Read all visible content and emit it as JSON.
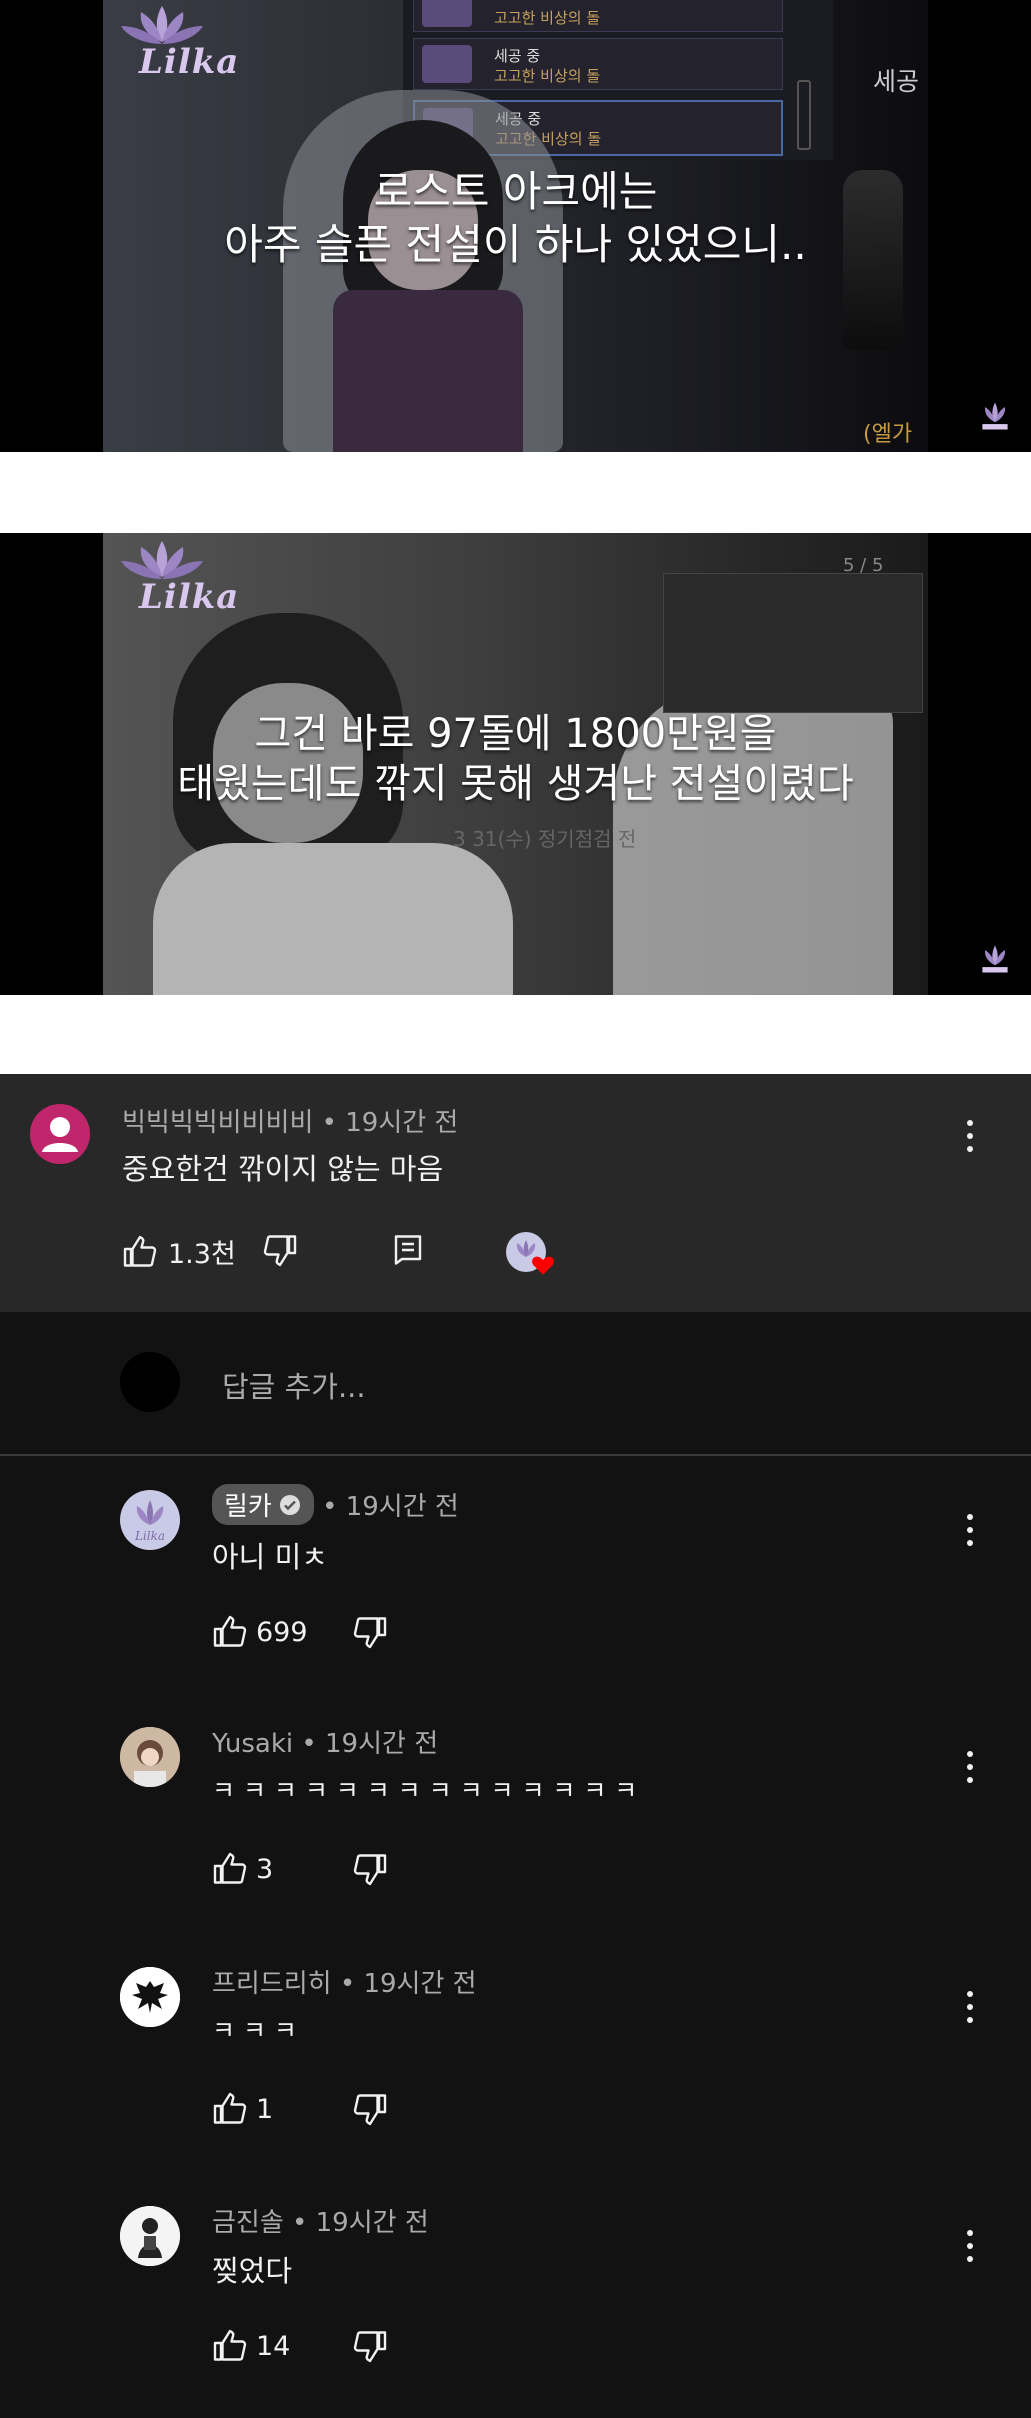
{
  "frames": [
    {
      "subtitle_line1": "로스트 아크에는",
      "subtitle_line2": "아주 슬픈 전설이 하나 있었으니..",
      "logo_text": "Lilka",
      "game_items": [
        {
          "status": "세공 중",
          "name": "고고한 비상의 돌"
        },
        {
          "status": "세공 중",
          "name": "고고한 비상의 돌"
        },
        {
          "status": "세공 중",
          "name": "고고한 비상의 돌"
        }
      ],
      "side_label": "세공",
      "corner_text": "(엘가시"
    },
    {
      "subtitle_line1": "그건 바로 97돌에 1800만원을",
      "subtitle_line2": "태웠는데도 깎지 못해 생겨난 전설이렸다",
      "logo_text": "Lilka",
      "counter": "5 / 5",
      "bg_text": "3 31(수) 정기점검 전"
    }
  ],
  "top_comment": {
    "author": "빅빅빅빅비비비비",
    "time": "• 19시간 전",
    "text": "중요한건 깎이지 않는 마음",
    "likes": "1.3천"
  },
  "reply_input": {
    "placeholder": "답글 추가..."
  },
  "replies": [
    {
      "author": "릴카",
      "time": "• 19시간 전",
      "text": "아니 미ㅊ",
      "likes": "699",
      "verified": true
    },
    {
      "author": "Yusaki",
      "time": "• 19시간 전",
      "text": "ㅋ ㅋ ㅋ ㅋ ㅋ ㅋ ㅋ ㅋ ㅋ ㅋ ㅋ ㅋ ㅋ ㅋ",
      "likes": "3"
    },
    {
      "author": "프리드리히",
      "time": "• 19시간 전",
      "text": "ㅋ ㅋ ㅋ",
      "likes": "1"
    },
    {
      "author": "금진솔",
      "time": "• 19시간 전",
      "text": "찢었다",
      "likes": "14"
    }
  ],
  "colors": {
    "background_comments": "#121212",
    "top_comment_bg": "#282828",
    "top_avatar": "#c0266b",
    "heart": "#ff0000"
  },
  "icons": [
    "like-icon",
    "dislike-icon",
    "reply-icon",
    "more-icon",
    "heart-icon"
  ]
}
